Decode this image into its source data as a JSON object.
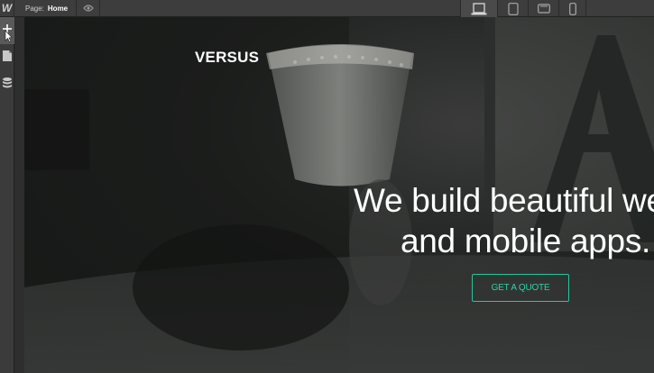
{
  "topbar": {
    "logo": "W",
    "page_prefix": "Page:",
    "page_name": "Home",
    "preview_icon": "eye-icon",
    "devices": [
      {
        "icon": "desktop-icon",
        "active": true
      },
      {
        "icon": "tablet-icon",
        "active": false
      },
      {
        "icon": "phone-landscape-icon",
        "active": false
      },
      {
        "icon": "phone-portrait-icon",
        "active": false
      }
    ]
  },
  "left_toolbar": {
    "tools": [
      {
        "icon": "add-icon",
        "active": true
      },
      {
        "icon": "pages-icon",
        "active": false
      },
      {
        "icon": "database-icon",
        "active": false
      }
    ]
  },
  "site": {
    "logo": "VERSUS",
    "hero_line1": "We build beautiful we",
    "hero_line2": "and mobile apps.",
    "cta_label": "GET A QUOTE"
  },
  "colors": {
    "accent": "#22c79c",
    "chrome": "#3d3d3d",
    "canvas_bg": "#1a1c1b"
  }
}
